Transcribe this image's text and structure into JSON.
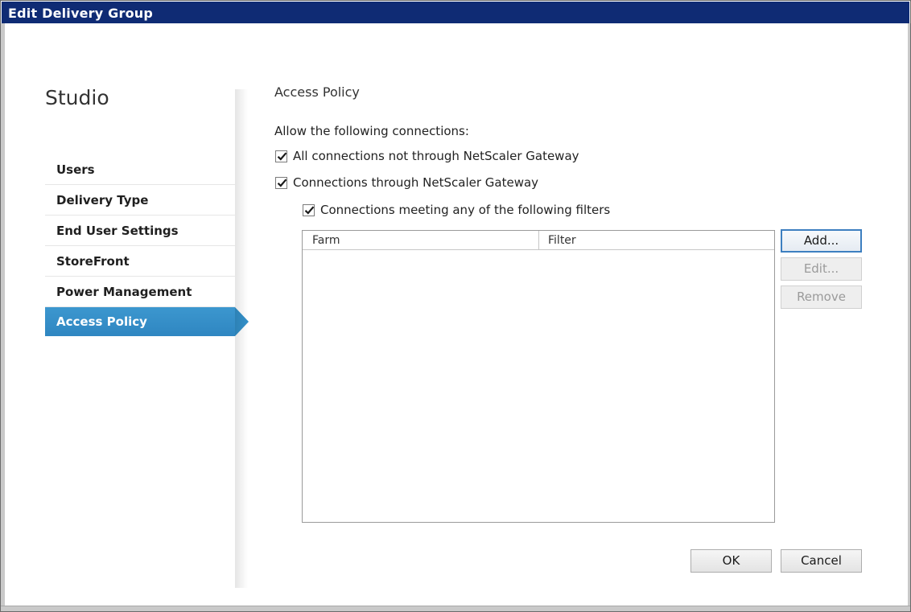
{
  "window": {
    "title": "Edit Delivery Group"
  },
  "sidebar": {
    "app_title": "Studio",
    "items": [
      {
        "label": "Users",
        "active": false
      },
      {
        "label": "Delivery Type",
        "active": false
      },
      {
        "label": "End User Settings",
        "active": false
      },
      {
        "label": "StoreFront",
        "active": false
      },
      {
        "label": "Power Management",
        "active": false
      },
      {
        "label": "Access Policy",
        "active": true
      }
    ],
    "active_color": "#3390c9"
  },
  "main": {
    "section_title": "Access Policy",
    "allow_label": "Allow the following connections:",
    "options": [
      {
        "label": "All connections not through NetScaler Gateway",
        "checked": true
      },
      {
        "label": "Connections through NetScaler Gateway",
        "checked": true
      },
      {
        "label": "Connections meeting any of the following filters",
        "checked": true
      }
    ],
    "filter_table": {
      "columns": [
        "Farm",
        "Filter"
      ],
      "rows": []
    },
    "side_buttons": {
      "add_label": "Add...",
      "edit_label": "Edit...",
      "remove_label": "Remove"
    }
  },
  "footer": {
    "ok_label": "OK",
    "cancel_label": "Cancel"
  },
  "colors": {
    "titlebar": "#0f2b74",
    "accent": "#3390c9"
  }
}
